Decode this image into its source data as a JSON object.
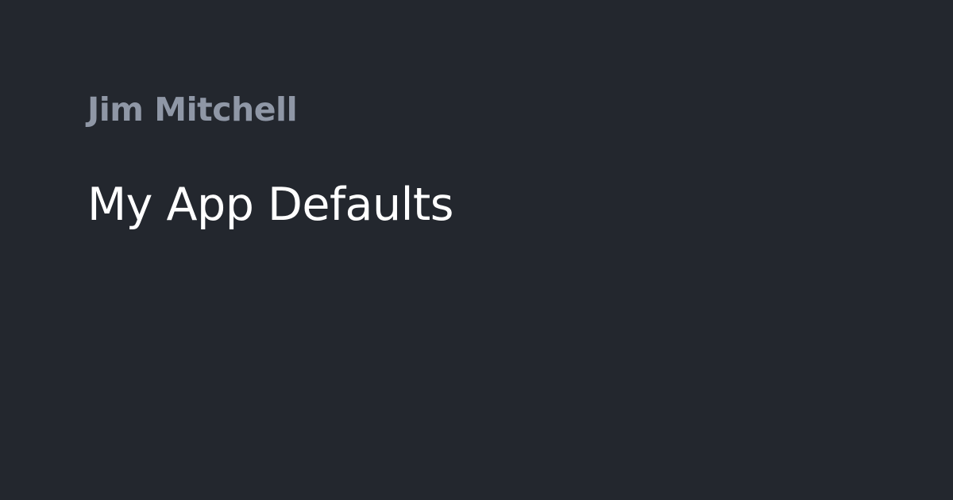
{
  "card": {
    "author": "Jim Mitchell",
    "title": "My App Defaults"
  },
  "colors": {
    "background": "#23272e",
    "author_text": "#8f97a6",
    "title_text": "#ffffff"
  }
}
